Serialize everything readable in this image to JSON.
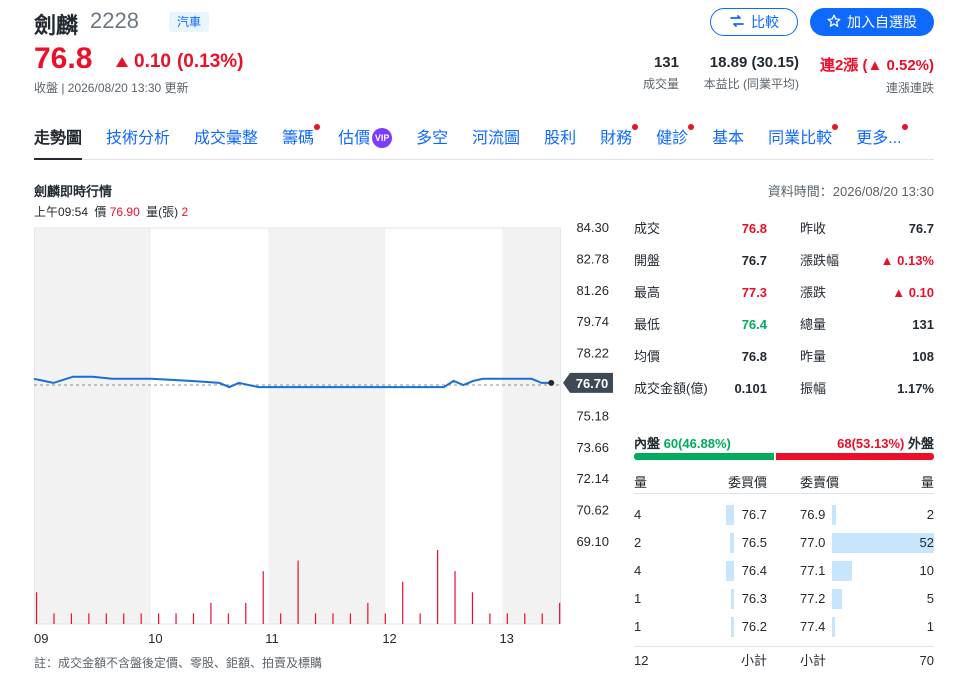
{
  "header": {
    "name": "劍麟",
    "code": "2228",
    "sector": "汽車",
    "compare_label": "比較",
    "watchlist_label": "加入自選股",
    "price": "76.8",
    "change": "0.10",
    "change_pct": "(0.13%)",
    "close_info": "收盤 | 2026/08/20 13:30 更新"
  },
  "stats": [
    {
      "value": "131",
      "label": "成交量"
    },
    {
      "value": "18.89 (30.15)",
      "label": "本益比 (同業平均)"
    },
    {
      "value": "連2漲 (▲ 0.52%)",
      "label": "連漲連跌"
    }
  ],
  "tabs": [
    {
      "label": "走勢圖",
      "active": true,
      "dot": false
    },
    {
      "label": "技術分析",
      "dot": false
    },
    {
      "label": "成交彙整",
      "dot": false
    },
    {
      "label": "籌碼",
      "dot": true
    },
    {
      "label": "估價",
      "vip": "VIP",
      "dot": false
    },
    {
      "label": "多空",
      "dot": false
    },
    {
      "label": "河流圖",
      "dot": false
    },
    {
      "label": "股利",
      "dot": false
    },
    {
      "label": "財務",
      "dot": true
    },
    {
      "label": "健診",
      "dot": true
    },
    {
      "label": "基本",
      "dot": false
    },
    {
      "label": "同業比較",
      "dot": true
    },
    {
      "label": "更多...",
      "dot": true
    }
  ],
  "chart_section": {
    "title": "劍麟即時行情",
    "data_time": "資料時間：2026/08/20 13:30",
    "tick_time": "上午09:54",
    "tick_price_label": "價",
    "tick_price": "76.90",
    "tick_vol_label": "量(張)",
    "tick_vol": "2",
    "current_price_tag": "76.70",
    "note": "註：成交金額不含盤後定價、零股、鉅額、拍賣及標購"
  },
  "chart_data": {
    "type": "line",
    "ylim": [
      69.1,
      84.3
    ],
    "y_ticks": [
      "84.30",
      "82.78",
      "81.26",
      "79.74",
      "78.22",
      "75.18",
      "73.66",
      "72.14",
      "70.62",
      "69.10"
    ],
    "x_ticks": [
      "09",
      "10",
      "11",
      "12",
      "13"
    ],
    "reference_price": 76.7,
    "series": [
      {
        "x": [
          "09:00",
          "09:05",
          "09:10",
          "09:20",
          "09:30",
          "09:40",
          "10:00",
          "10:20",
          "10:35",
          "10:40",
          "10:45",
          "10:55",
          "11:00",
          "11:30",
          "12:00",
          "12:30",
          "12:35",
          "12:40",
          "12:45",
          "12:50",
          "13:00",
          "13:15",
          "13:20",
          "13:25"
        ],
        "values": [
          77.0,
          76.9,
          76.8,
          77.1,
          77.1,
          77.0,
          77.0,
          76.9,
          76.8,
          76.6,
          76.8,
          76.6,
          76.6,
          76.6,
          76.6,
          76.6,
          76.9,
          76.7,
          76.9,
          77.0,
          77.0,
          77.0,
          76.8,
          76.8
        ]
      }
    ],
    "volume": [
      3,
      1,
      1,
      1,
      1,
      1,
      1,
      1,
      1,
      1,
      2,
      1,
      2,
      5,
      1,
      6,
      1,
      1,
      1,
      2,
      1,
      4,
      1,
      7,
      5,
      3,
      1,
      1,
      1,
      1,
      2
    ]
  },
  "quote": {
    "left": [
      {
        "label": "成交",
        "value": "76.8",
        "color": "red"
      },
      {
        "label": "開盤",
        "value": "76.7",
        "color": "black"
      },
      {
        "label": "最高",
        "value": "77.3",
        "color": "red"
      },
      {
        "label": "最低",
        "value": "76.4",
        "color": "green"
      },
      {
        "label": "均價",
        "value": "76.8",
        "color": "black"
      },
      {
        "label": "成交金額(億)",
        "value": "0.101",
        "color": "black"
      }
    ],
    "right": [
      {
        "label": "昨收",
        "value": "76.7",
        "color": "black"
      },
      {
        "label": "漲跌幅",
        "value": "▲ 0.13%",
        "color": "red"
      },
      {
        "label": "漲跌",
        "value": "▲ 0.10",
        "color": "red"
      },
      {
        "label": "總量",
        "value": "131",
        "color": "black"
      },
      {
        "label": "昨量",
        "value": "108",
        "color": "black"
      },
      {
        "label": "振幅",
        "value": "1.17%",
        "color": "black"
      }
    ]
  },
  "pressure": {
    "inner_label": "內盤",
    "inner_value": "60(46.88%)",
    "inner_ratio": 0.4688,
    "outer_value": "68(53.13%)",
    "outer_label": "外盤"
  },
  "orderbook": {
    "head": {
      "bid_qty": "量",
      "bid_price": "委買價",
      "ask_price": "委賣價",
      "ask_qty": "量"
    },
    "bids": [
      {
        "qty": "4",
        "price": "76.7",
        "ratio": 0.077
      },
      {
        "qty": "2",
        "price": "76.5",
        "ratio": 0.038
      },
      {
        "qty": "4",
        "price": "76.4",
        "ratio": 0.077
      },
      {
        "qty": "1",
        "price": "76.3",
        "ratio": 0.019
      },
      {
        "qty": "1",
        "price": "76.2",
        "ratio": 0.019
      }
    ],
    "asks": [
      {
        "price": "76.9",
        "qty": "2",
        "ratio": 0.038
      },
      {
        "price": "77.0",
        "qty": "52",
        "ratio": 1.0
      },
      {
        "price": "77.1",
        "qty": "10",
        "ratio": 0.192
      },
      {
        "price": "77.2",
        "qty": "5",
        "ratio": 0.096
      },
      {
        "price": "77.4",
        "qty": "1",
        "ratio": 0.019
      }
    ],
    "foot": {
      "bid_total": "12",
      "bid_label": "小計",
      "ask_label": "小計",
      "ask_total": "70"
    }
  },
  "colors": {
    "accent": "#0f69ff",
    "up": "#eb0f29",
    "down": "#00ab5e",
    "line": "#1a6ed8",
    "bar": "#c7e5fd"
  }
}
